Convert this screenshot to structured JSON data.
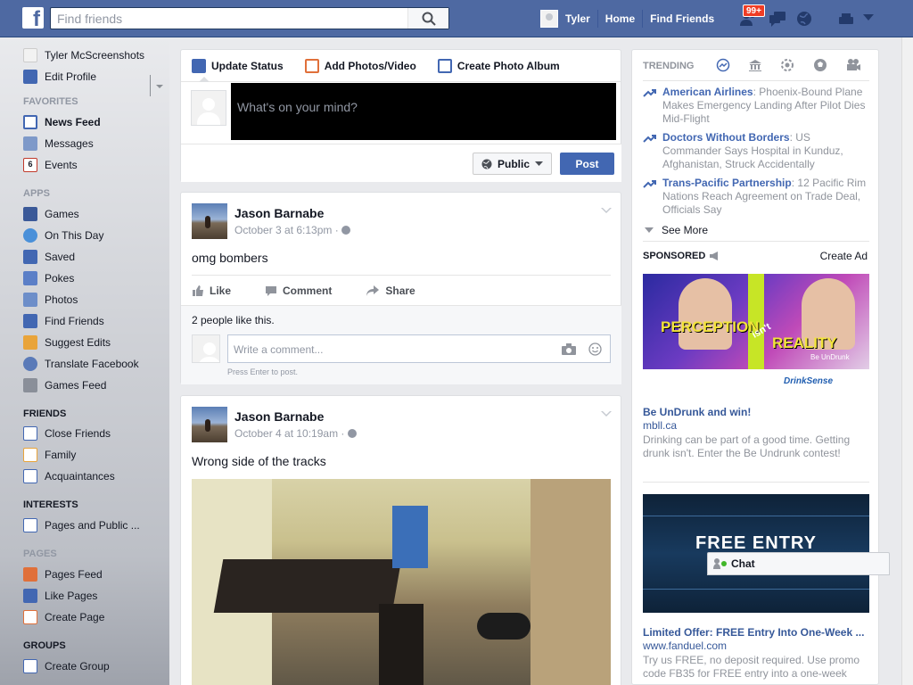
{
  "topbar": {
    "logo": "f",
    "search_placeholder": "Find friends",
    "user_name": "Tyler",
    "home": "Home",
    "find_friends": "Find Friends",
    "friend_requests_badge": "99+",
    "accent": "#4e69a2"
  },
  "sidebar": {
    "profile_name": "Tyler McScreenshots",
    "edit_profile": "Edit Profile",
    "favorites_heading": "FAVORITES",
    "favorites": [
      {
        "label": "News Feed",
        "icon": "news-feed-icon"
      },
      {
        "label": "Messages",
        "icon": "messages-icon"
      },
      {
        "label": "Events",
        "icon": "events-icon",
        "badge": "6"
      }
    ],
    "apps_heading": "APPS",
    "apps": [
      {
        "label": "Games",
        "icon": "games-icon"
      },
      {
        "label": "On This Day",
        "icon": "on-this-day-icon"
      },
      {
        "label": "Saved",
        "icon": "saved-icon"
      },
      {
        "label": "Pokes",
        "icon": "pokes-icon"
      },
      {
        "label": "Photos",
        "icon": "photos-icon"
      },
      {
        "label": "Find Friends",
        "icon": "find-friends-icon"
      },
      {
        "label": "Suggest Edits",
        "icon": "suggest-edits-icon"
      },
      {
        "label": "Translate Facebook",
        "icon": "translate-icon"
      },
      {
        "label": "Games Feed",
        "icon": "games-feed-icon"
      }
    ],
    "friends_heading": "FRIENDS",
    "friends": [
      {
        "label": "Close Friends",
        "icon": "close-friends-icon"
      },
      {
        "label": "Family",
        "icon": "family-icon"
      },
      {
        "label": "Acquaintances",
        "icon": "acquaintances-icon"
      }
    ],
    "interests_heading": "INTERESTS",
    "interests": [
      {
        "label": "Pages and Public ...",
        "icon": "pages-public-icon"
      }
    ],
    "pages_heading": "PAGES",
    "pages": [
      {
        "label": "Pages Feed",
        "icon": "pages-feed-icon"
      },
      {
        "label": "Like Pages",
        "icon": "like-pages-icon"
      },
      {
        "label": "Create Page",
        "icon": "create-page-icon"
      }
    ],
    "groups_heading": "GROUPS",
    "groups": [
      {
        "label": "Create Group",
        "icon": "create-group-icon"
      }
    ]
  },
  "composer": {
    "tabs": [
      "Update Status",
      "Add Photos/Video",
      "Create Photo Album"
    ],
    "placeholder": "What's on your mind?",
    "privacy": "Public",
    "post_button": "Post"
  },
  "posts": [
    {
      "author": "Jason Barnabe",
      "time": "October 3 at 6:13pm",
      "text": "omg bombers",
      "actions": [
        "Like",
        "Comment",
        "Share"
      ],
      "likes": "2 people like this.",
      "comment_placeholder": "Write a comment...",
      "comment_hint": "Press Enter to post."
    },
    {
      "author": "Jason Barnabe",
      "time": "October 4 at 10:19am",
      "text": "Wrong side of the tracks"
    }
  ],
  "trending": {
    "heading": "TRENDING",
    "items": [
      {
        "topic": "American Airlines",
        "desc": ": Phoenix-Bound Plane Makes Emergency Landing After Pilot Dies Mid-Flight"
      },
      {
        "topic": "Doctors Without Borders",
        "desc": ": US Commander Says Hospital in Kunduz, Afghanistan, Struck Accidentally"
      },
      {
        "topic": "Trans-Pacific Partnership",
        "desc": ": 12 Pacific Rim Nations Reach Agreement on Trade Deal, Officials Say"
      }
    ],
    "see_more": "See More"
  },
  "sponsored": {
    "heading": "SPONSORED",
    "create_ad": "Create Ad",
    "ads": [
      {
        "image_text_1": "PERCEPTION",
        "image_text_2": "isn't",
        "image_text_3": "REALITY",
        "image_text_4": "Be UnDrunk",
        "image_text_5": "DrinkSense",
        "title": "Be UnDrunk and win!",
        "domain": "mbll.ca",
        "body": "Drinking can be part of a good time. Getting drunk isn't. Enter the Be Undrunk contest!"
      },
      {
        "image_text": "FREE ENTRY",
        "title": "Limited Offer: FREE Entry Into One-Week ...",
        "domain": "www.fanduel.com",
        "body": "Try us FREE, no deposit required. Use promo code FB35 for FREE entry into a one-week"
      }
    ]
  },
  "chat": {
    "label": "Chat"
  }
}
